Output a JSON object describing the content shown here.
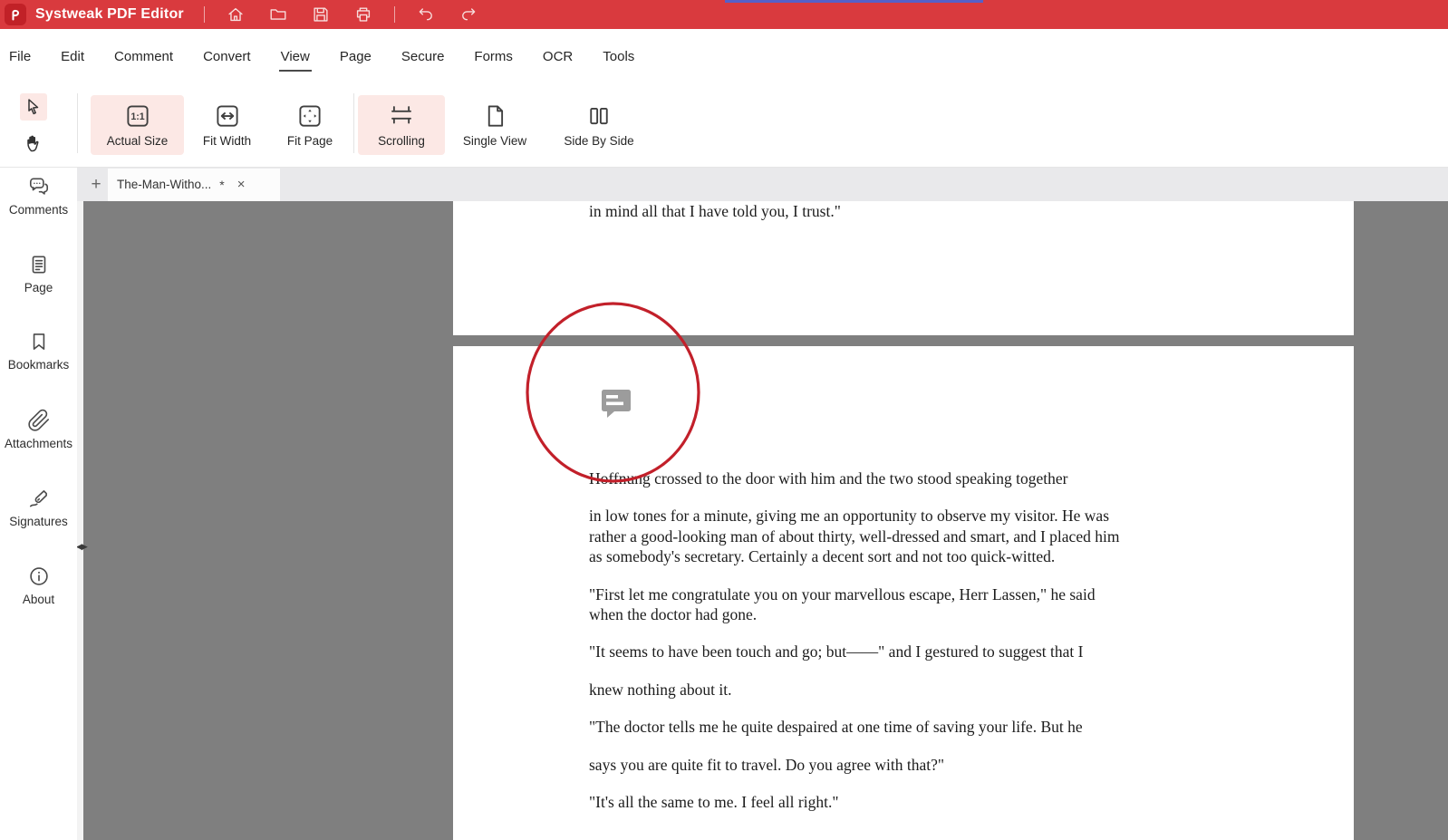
{
  "titlebar": {
    "app_name": "Systweak PDF Editor",
    "bg_color": "#d93a3e",
    "accent_strip_color": "#5560c8",
    "icons": [
      "home-icon",
      "open-folder-icon",
      "save-icon",
      "print-icon",
      "undo-icon",
      "redo-icon"
    ]
  },
  "menubar": {
    "items": [
      {
        "label": "File"
      },
      {
        "label": "Edit"
      },
      {
        "label": "Comment"
      },
      {
        "label": "Convert"
      },
      {
        "label": "View",
        "selected": true
      },
      {
        "label": "Page"
      },
      {
        "label": "Secure"
      },
      {
        "label": "Forms"
      },
      {
        "label": "OCR"
      },
      {
        "label": "Tools"
      }
    ]
  },
  "toolbar": {
    "highlight_color": "#fce8e5",
    "select_tool": {
      "name": "cursor-select-tool",
      "active": true
    },
    "hand_tool": {
      "name": "hand-pan-tool",
      "active": false
    },
    "buttons": [
      {
        "label": "Actual Size",
        "icon": "actual-size-icon",
        "active": true
      },
      {
        "label": "Fit Width",
        "icon": "fit-width-icon",
        "active": false
      },
      {
        "label": "Fit Page",
        "icon": "fit-page-icon",
        "active": false
      },
      {
        "label": "Scrolling",
        "icon": "scrolling-icon",
        "active": true
      },
      {
        "label": "Single View",
        "icon": "single-view-icon",
        "active": false
      },
      {
        "label": "Side By Side",
        "icon": "side-by-side-icon",
        "active": false
      }
    ]
  },
  "tabbar": {
    "new_tab_label": "+",
    "tab": {
      "title": "The-Man-Witho...",
      "modified": "*",
      "close": "×"
    }
  },
  "sidebar": {
    "items": [
      {
        "label": "Comments",
        "icon": "comments-icon"
      },
      {
        "label": "Page",
        "icon": "page-icon"
      },
      {
        "label": "Bookmarks",
        "icon": "bookmarks-icon"
      },
      {
        "label": "Attachments",
        "icon": "attachments-icon"
      },
      {
        "label": "Signatures",
        "icon": "signatures-icon"
      },
      {
        "label": "About",
        "icon": "about-icon"
      }
    ]
  },
  "document": {
    "background_color": "#7f7f7f",
    "annotation_circle_color": "#c2202a",
    "comment_marker_color": "#9c9c9c",
    "page1_last_line": "in mind all that I have told you, I trust.\"",
    "paragraphs": [
      {
        "lines": [
          "Hoffnung crossed to the door with him and the two stood speaking together"
        ]
      },
      {
        "lines": [
          "in low tones for a minute, giving me an opportunity to observe my visitor. He was",
          "rather a good-looking man of about thirty, well-dressed and smart, and I placed him",
          "as somebody's secretary. Certainly a decent sort and not too quick-witted."
        ]
      },
      {
        "lines": [
          "\"First let me congratulate you on your marvellous escape, Herr Lassen,\" he said",
          "when the doctor had gone."
        ]
      },
      {
        "lines": [
          "\"It seems to have been touch and go; but——\" and I gestured to suggest that I"
        ]
      },
      {
        "lines": [
          "knew nothing about it."
        ]
      },
      {
        "lines": [
          "\"The doctor tells me he quite despaired at one time of saving your life. But he"
        ]
      },
      {
        "lines": [
          "says you are quite fit to travel. Do you agree with that?\""
        ]
      },
      {
        "lines": [
          "\"It's all the same to me. I feel all right.\""
        ]
      }
    ]
  }
}
